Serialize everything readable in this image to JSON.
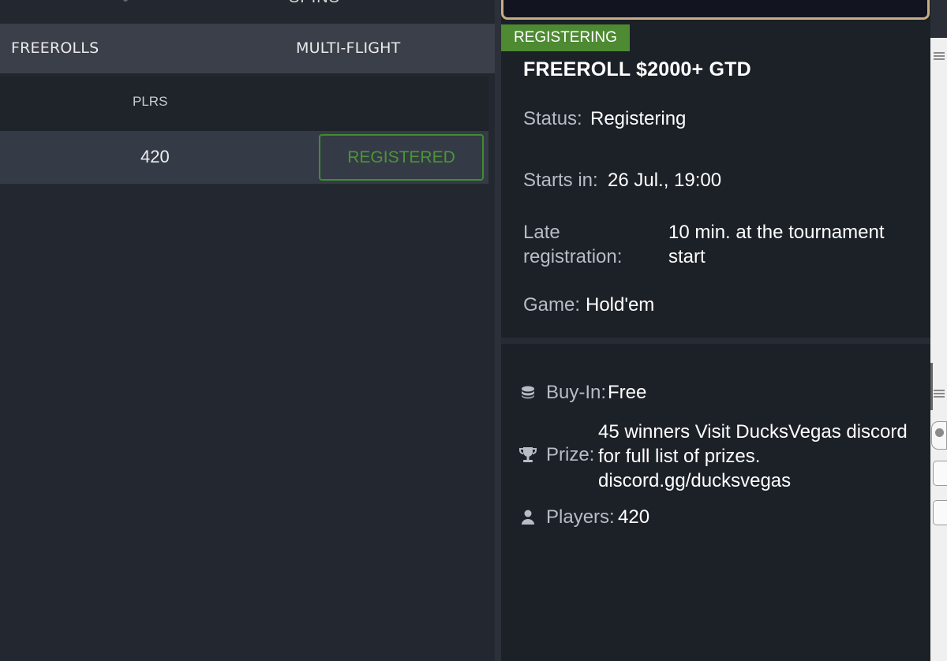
{
  "top_cut": {
    "label": "SPINS"
  },
  "filters": {
    "freerolls": "FREEROLLS",
    "multi_flight": "MULTI-FLIGHT"
  },
  "list": {
    "columns": {
      "players": "PLRS"
    },
    "rows": [
      {
        "players": "420",
        "action": "REGISTERED"
      }
    ]
  },
  "details": {
    "status_badge": "REGISTERING",
    "title": "FREEROLL $2000+ GTD",
    "status_label": "Status:",
    "status_value": "Registering",
    "starts_label": "Starts in:",
    "starts_value": "26 Jul., 19:00",
    "late_label": "Late registration:",
    "late_value": "10 min. at the tournament start",
    "game_label": "Game:",
    "game_value": "Hold'em",
    "buyin_label": "Buy-In:",
    "buyin_value": "Free",
    "prize_label": "Prize:",
    "prize_value": "45 winners Visit DucksVegas discord for full list of prizes. discord.gg/ducksvegas",
    "players_label": "Players:",
    "players_value": "420"
  },
  "icons": {
    "buyin": "coins-icon",
    "prize": "trophy-icon",
    "players": "player-icon"
  },
  "colors": {
    "badge_green": "#4d8a32",
    "registered_green": "#4a9637",
    "frame_gold": "#c7ae84"
  }
}
